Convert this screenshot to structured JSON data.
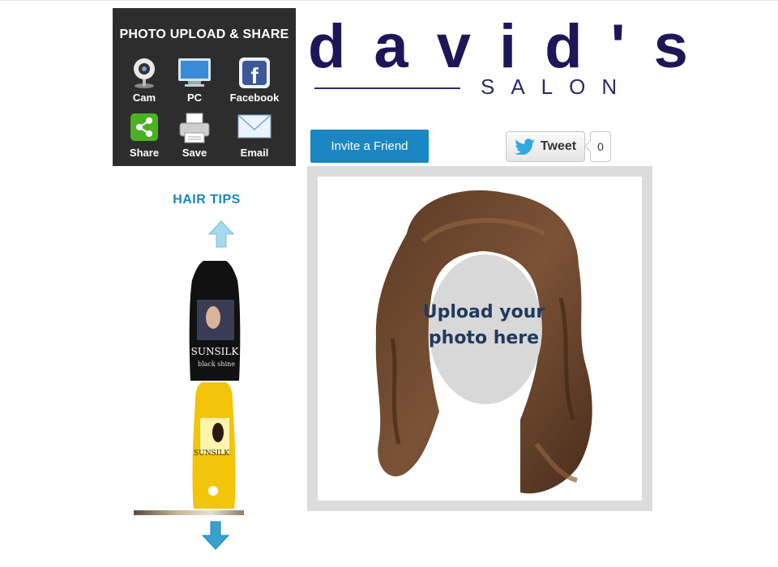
{
  "panel": {
    "title": "PHOTO UPLOAD & SHARE",
    "tools": [
      {
        "label": "Cam",
        "icon": "webcam-icon"
      },
      {
        "label": "PC",
        "icon": "monitor-icon"
      },
      {
        "label": "Facebook",
        "icon": "facebook-icon"
      },
      {
        "label": "Share",
        "icon": "share-icon"
      },
      {
        "label": "Save",
        "icon": "printer-icon"
      },
      {
        "label": "Email",
        "icon": "envelope-icon"
      }
    ]
  },
  "logo": {
    "main": "david's",
    "sub": "SALON",
    "color": "#1d1759"
  },
  "social": {
    "invite_label": "Invite a Friend",
    "tweet_label": "Tweet",
    "tweet_count": "0"
  },
  "stage": {
    "upload_line1": "Upload your",
    "upload_line2": "photo here"
  },
  "tips": {
    "title": "HAIR TIPS",
    "products": [
      {
        "brand": "SUNSILK",
        "variant": "black shine"
      },
      {
        "brand": "SUNSILK",
        "variant": ""
      }
    ]
  },
  "colors": {
    "accent": "#1a86c2",
    "panel_bg": "#2d2d2d"
  }
}
